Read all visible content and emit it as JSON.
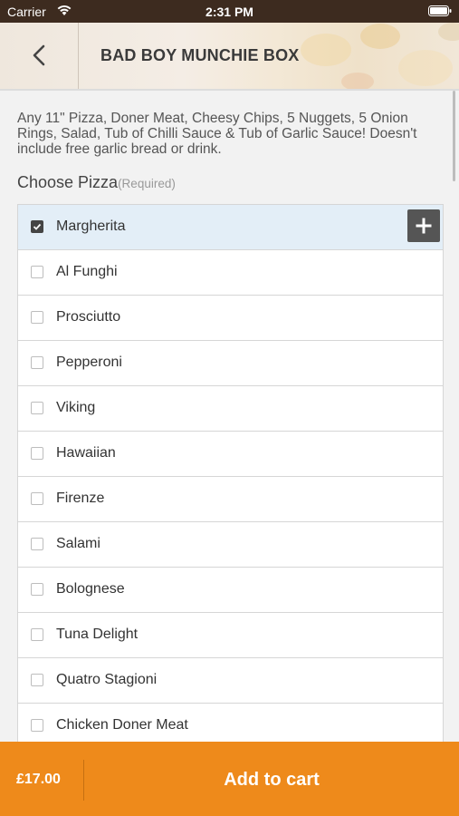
{
  "status_bar": {
    "carrier": "Carrier",
    "time": "2:31 PM"
  },
  "header": {
    "title": "BAD BOY MUNCHIE BOX"
  },
  "description": "Any 11\" Pizza, Doner Meat, Cheesy Chips, 5 Nuggets, 5 Onion Rings, Salad, Tub of Chilli Sauce & Tub of Garlic Sauce! Doesn't include free garlic bread or drink.",
  "section": {
    "title": "Choose Pizza",
    "required_label": "(Required)"
  },
  "options": [
    {
      "label": "Margherita",
      "checked": true
    },
    {
      "label": "Al Funghi",
      "checked": false
    },
    {
      "label": "Prosciutto",
      "checked": false
    },
    {
      "label": "Pepperoni",
      "checked": false
    },
    {
      "label": "Viking",
      "checked": false
    },
    {
      "label": "Hawaiian",
      "checked": false
    },
    {
      "label": "Firenze",
      "checked": false
    },
    {
      "label": "Salami",
      "checked": false
    },
    {
      "label": "Bolognese",
      "checked": false
    },
    {
      "label": "Tuna Delight",
      "checked": false
    },
    {
      "label": "Quatro Stagioni",
      "checked": false
    },
    {
      "label": "Chicken Doner Meat",
      "checked": false
    }
  ],
  "footer": {
    "price": "£17.00",
    "add_to_cart_label": "Add to cart"
  },
  "colors": {
    "accent": "#ee8a1b",
    "selected_row": "#e3eef7",
    "status_bar": "#3d2b1f"
  }
}
